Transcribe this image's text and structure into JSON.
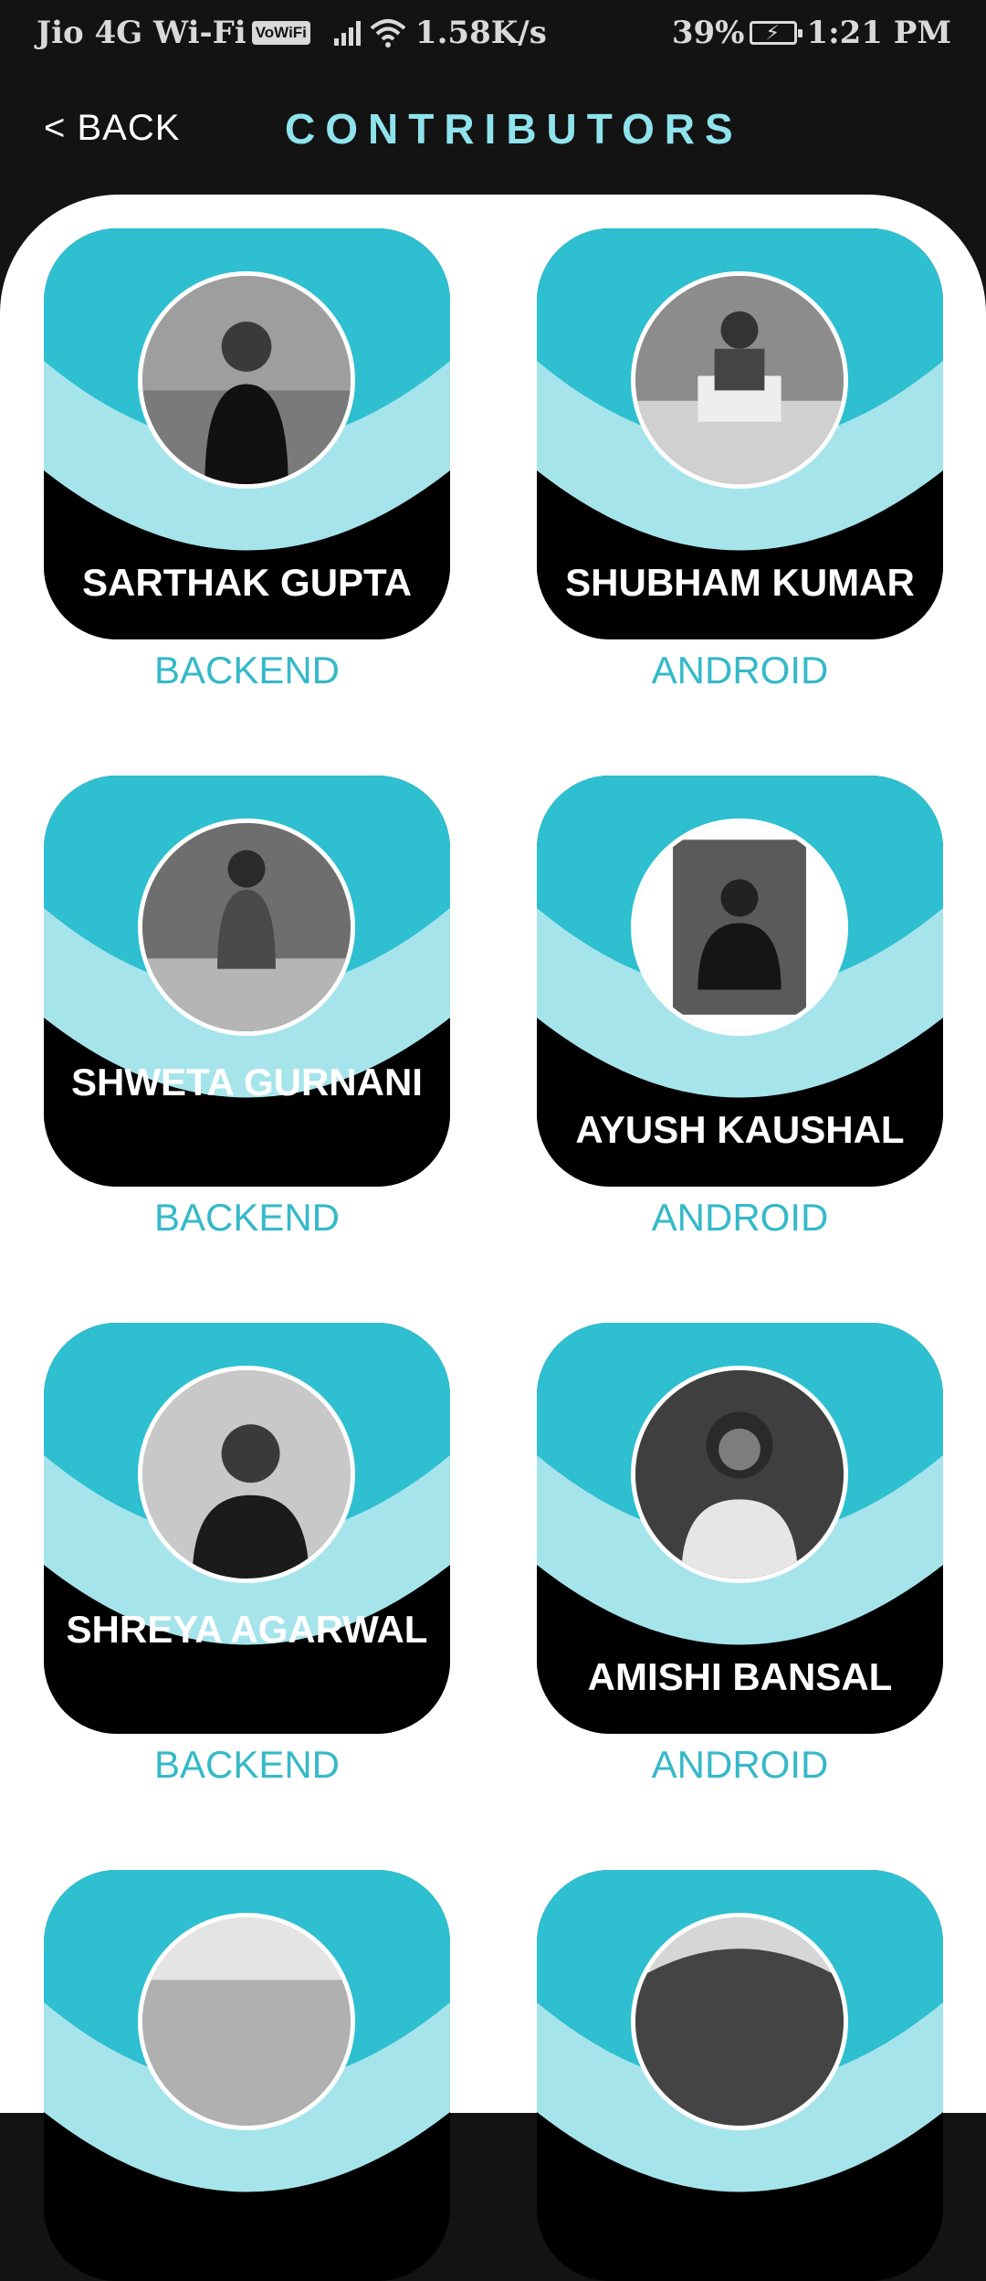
{
  "status_bar": {
    "carrier": "Jio 4G Wi-Fi",
    "vowifi": "VoWiFi",
    "speed": "1.58K/s",
    "battery": "39%",
    "time": "1:21 PM"
  },
  "header": {
    "back_label": "< BACK",
    "title": "CONTRIBUTORS"
  },
  "colors": {
    "accent": "#2ebfd1",
    "light_accent": "#a6e4ec",
    "role_text": "#35b9c9",
    "title_text": "#8fe3ec"
  },
  "contributors": [
    {
      "name": "SARTHAK GUPTA",
      "role": "BACKEND"
    },
    {
      "name": "SHUBHAM KUMAR",
      "role": "ANDROID"
    },
    {
      "name": "SHWETA GURNANI",
      "role": "BACKEND"
    },
    {
      "name": "AYUSH KAUSHAL",
      "role": "ANDROID"
    },
    {
      "name": "SHREYA AGARWAL",
      "role": "BACKEND"
    },
    {
      "name": "AMISHI BANSAL",
      "role": "ANDROID"
    },
    {
      "name": "",
      "role": ""
    },
    {
      "name": "",
      "role": ""
    }
  ]
}
